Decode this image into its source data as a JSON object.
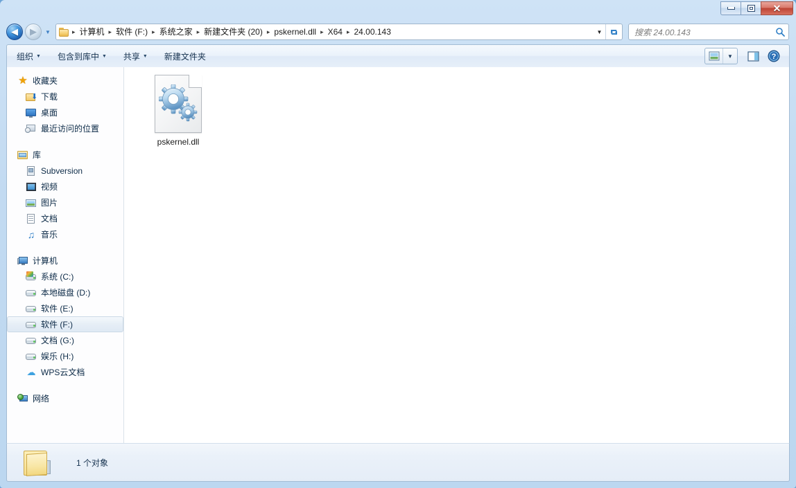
{
  "window": {
    "title": "",
    "buttons": {
      "minimize": "minimize",
      "maximize": "restore",
      "close": "✕"
    }
  },
  "navigation": {
    "back_label": "◀",
    "forward_label": "▶",
    "history_label": "▼",
    "breadcrumb": [
      "计算机",
      "软件 (F:)",
      "系统之家",
      "新建文件夹 (20)",
      "pskernel.dll",
      "X64",
      "24.00.143"
    ],
    "separator": "▸",
    "dropdown_label": "▼",
    "refresh_label": "refresh-icon"
  },
  "search": {
    "placeholder": "搜索 24.00.143",
    "value": "",
    "icon": "search-icon"
  },
  "toolbar": {
    "items": [
      {
        "label": "组织",
        "has_caret": true
      },
      {
        "label": "包含到库中",
        "has_caret": true
      },
      {
        "label": "共享",
        "has_caret": true
      },
      {
        "label": "新建文件夹",
        "has_caret": false
      }
    ],
    "caret": "▼",
    "view_icon": "change-view-icon",
    "view_caret": "▼",
    "preview_icon": "preview-pane-icon",
    "help_icon": "help-icon"
  },
  "sidebar": {
    "groups": [
      {
        "header": {
          "label": "收藏夹",
          "icon": "favorites-star-icon"
        },
        "items": [
          {
            "label": "下载",
            "icon": "downloads-icon"
          },
          {
            "label": "桌面",
            "icon": "desktop-icon"
          },
          {
            "label": "最近访问的位置",
            "icon": "recent-places-icon"
          }
        ]
      },
      {
        "header": {
          "label": "库",
          "icon": "libraries-icon"
        },
        "items": [
          {
            "label": "Subversion",
            "icon": "subversion-icon"
          },
          {
            "label": "视频",
            "icon": "videos-icon"
          },
          {
            "label": "图片",
            "icon": "pictures-icon"
          },
          {
            "label": "文档",
            "icon": "documents-icon"
          },
          {
            "label": "音乐",
            "icon": "music-icon"
          }
        ]
      },
      {
        "header": {
          "label": "计算机",
          "icon": "computer-icon"
        },
        "items": [
          {
            "label": "系统 (C:)",
            "icon": "system-drive-icon",
            "selected": false
          },
          {
            "label": "本地磁盘 (D:)",
            "icon": "drive-icon",
            "selected": false
          },
          {
            "label": "软件 (E:)",
            "icon": "drive-icon",
            "selected": false
          },
          {
            "label": "软件 (F:)",
            "icon": "drive-icon",
            "selected": true
          },
          {
            "label": "文档 (G:)",
            "icon": "drive-icon",
            "selected": false
          },
          {
            "label": "娱乐 (H:)",
            "icon": "drive-icon",
            "selected": false
          },
          {
            "label": "WPS云文档",
            "icon": "cloud-icon",
            "selected": false
          }
        ]
      },
      {
        "header": {
          "label": "网络",
          "icon": "network-icon"
        },
        "items": []
      }
    ]
  },
  "content": {
    "files": [
      {
        "name": "pskernel.dll",
        "icon": "dll-gears-icon",
        "selected": false
      }
    ]
  },
  "statusbar": {
    "folder_icon": "folder-icon",
    "text": "1 个对象"
  },
  "colors": {
    "accent": "#3c7fc4",
    "title_glass": "#c2daf1",
    "close_button": "#bc4434",
    "selection": "#e6eef6",
    "text": "#16324f"
  }
}
